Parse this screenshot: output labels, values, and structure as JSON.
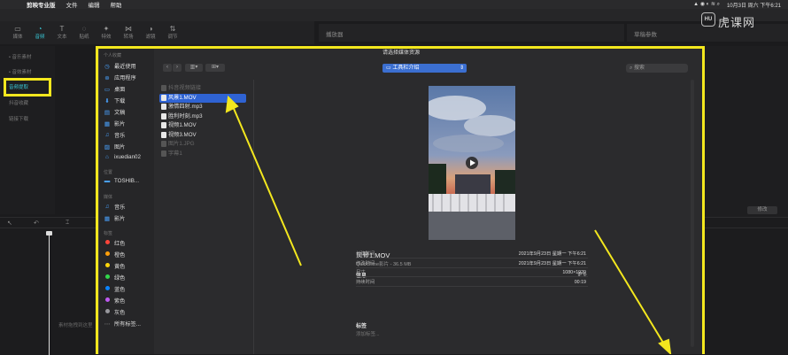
{
  "menubar": {
    "app": "剪映专业版",
    "file": "文件",
    "edit": "编辑",
    "help": "帮助",
    "datetime": "10月3日 周六 下午6:21"
  },
  "watermark": {
    "brand": "虎课网",
    "logo_text": "HU"
  },
  "toolbar": [
    {
      "label": "媒体",
      "icon": "media-icon"
    },
    {
      "label": "音频",
      "icon": "audio-icon"
    },
    {
      "label": "文本",
      "icon": "text-icon"
    },
    {
      "label": "贴纸",
      "icon": "sticker-icon"
    },
    {
      "label": "特效",
      "icon": "effect-icon"
    },
    {
      "label": "转场",
      "icon": "transition-icon"
    },
    {
      "label": "滤镜",
      "icon": "filter-icon"
    },
    {
      "label": "调节",
      "icon": "adjust-icon"
    }
  ],
  "panels": {
    "player": "播放器",
    "draft_params": "草稿参数",
    "modify": "修改"
  },
  "left_sidebar": [
    "• 音乐素材",
    "• 音效素材",
    "音频提取",
    "抖音收藏",
    "链接下载"
  ],
  "dialog": {
    "title": "请选择媒体资源",
    "location": "工具栏介绍",
    "search_placeholder": "搜索",
    "sidebar": {
      "favorites_header": "个人收藏",
      "favorites": [
        {
          "label": "最近使用",
          "icon": "clock-icon"
        },
        {
          "label": "应用程序",
          "icon": "applications-icon"
        },
        {
          "label": "桌面",
          "icon": "desktop-icon"
        },
        {
          "label": "下载",
          "icon": "download-icon"
        },
        {
          "label": "文稿",
          "icon": "document-icon"
        },
        {
          "label": "影片",
          "icon": "movies-icon"
        },
        {
          "label": "音乐",
          "icon": "music-icon"
        },
        {
          "label": "图片",
          "icon": "pictures-icon"
        },
        {
          "label": "ixuedian02",
          "icon": "home-icon"
        }
      ],
      "locations_header": "位置",
      "locations": [
        {
          "label": "TOSHIB...",
          "icon": "drive-icon"
        }
      ],
      "media_header": "媒体",
      "media": [
        {
          "label": "音乐",
          "icon": "music-icon"
        },
        {
          "label": "影片",
          "icon": "movies-icon"
        }
      ],
      "tags_header": "标签",
      "tags": [
        {
          "label": "红色",
          "color": "#ff453a"
        },
        {
          "label": "橙色",
          "color": "#ff9f0a"
        },
        {
          "label": "黄色",
          "color": "#ffd60a"
        },
        {
          "label": "绿色",
          "color": "#32d74b"
        },
        {
          "label": "蓝色",
          "color": "#0a84ff"
        },
        {
          "label": "紫色",
          "color": "#bf5af2"
        },
        {
          "label": "灰色",
          "color": "#98989d"
        },
        {
          "label": "所有标签...",
          "color": ""
        }
      ]
    },
    "files": [
      {
        "name": "抖音视频链接",
        "dim": true
      },
      {
        "name": "风景1.MOV",
        "selected": true
      },
      {
        "name": "激情四射.mp3"
      },
      {
        "name": "胜利时刻.mp3"
      },
      {
        "name": "视频1.MOV"
      },
      {
        "name": "视频3.MOV"
      },
      {
        "name": "图片1.JPG",
        "dim": true
      },
      {
        "name": "字幕1",
        "dim": true
      }
    ],
    "preview": {
      "filename": "风景1.MOV",
      "subtitle": "QuickTime影片 - 36.5 MB",
      "info_header": "信息",
      "more": "更多",
      "rows": [
        {
          "label": "创建时间",
          "value": "2021年9月23日 星期一 下午6:21"
        },
        {
          "label": "修改时间",
          "value": "2021年9月23日 星期一 下午6:21"
        },
        {
          "label": "尺寸",
          "value": "1080×1920"
        },
        {
          "label": "持续时间",
          "value": "00:19"
        }
      ],
      "tags_header": "标签",
      "add_tags": "添加标签..."
    }
  },
  "timeline": {
    "hint": "素材拖拽到这里"
  }
}
